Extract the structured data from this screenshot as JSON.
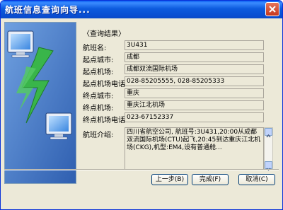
{
  "window": {
    "title": "航班信息查询向导..."
  },
  "section": {
    "label": "〈查询结果〉"
  },
  "fields": [
    {
      "label": "航班名:",
      "value": "3U431"
    },
    {
      "label": "起点城市:",
      "value": "成都"
    },
    {
      "label": "起点机场:",
      "value": "成都双流国际机场"
    },
    {
      "label": "起点机场电话:",
      "value": "028-85205555, 028-85205333"
    },
    {
      "label": "终点城市:",
      "value": "重庆"
    },
    {
      "label": "终点机场:",
      "value": "重庆江北机场"
    },
    {
      "label": "终点机场电话:",
      "value": "023-67152337"
    }
  ],
  "intro": {
    "label": "航班介绍:",
    "text": "四川省航空公司, 航班号:3U431,20:00从成都双流国际机场(CTU)起飞,20:45到达重庆江北机场(CKG),机型:EM4,设有普通舱..."
  },
  "buttons": {
    "back": "上一步(B)",
    "finish": "完成(F)",
    "cancel": "取消(C)"
  },
  "icons": {
    "close": "close-icon",
    "monitor": "monitor-icon",
    "lightning": "lightning-icon"
  },
  "colors": {
    "titlebar": "#0a4fd3",
    "window_bg": "#ece9d8",
    "panel_bg": "#3b6fc0",
    "lightning": "#39b54a"
  }
}
